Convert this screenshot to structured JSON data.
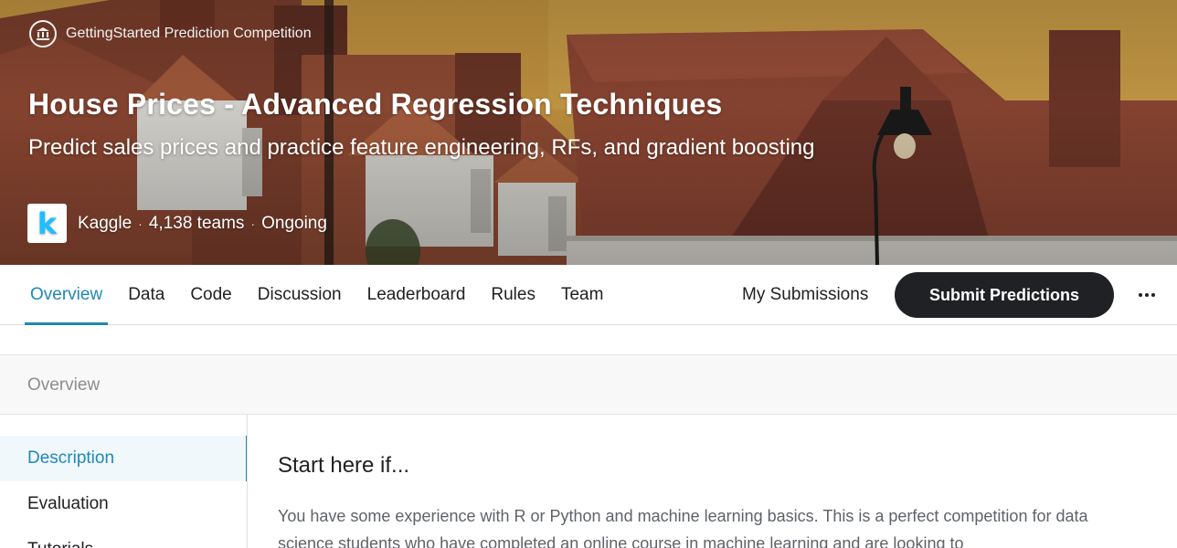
{
  "hero": {
    "competition_type": "GettingStarted Prediction Competition",
    "type_icon": "institution-icon",
    "title": "House Prices - Advanced Regression Techniques",
    "subtitle": "Predict sales prices and practice feature engineering, RFs, and gradient boosting",
    "organizer": "Kaggle",
    "organizer_logo_letter": "k",
    "teams": "4,138 teams",
    "status": "Ongoing",
    "separator": "·"
  },
  "tabs": [
    {
      "label": "Overview",
      "active": true
    },
    {
      "label": "Data"
    },
    {
      "label": "Code"
    },
    {
      "label": "Discussion"
    },
    {
      "label": "Leaderboard"
    },
    {
      "label": "Rules"
    },
    {
      "label": "Team"
    }
  ],
  "actions": {
    "my_submissions": "My Submissions",
    "submit_predictions": "Submit Predictions",
    "more_icon": "more-horizontal-icon"
  },
  "section": {
    "title": "Overview"
  },
  "side_nav": [
    {
      "label": "Description",
      "active": true
    },
    {
      "label": "Evaluation"
    },
    {
      "label": "Tutorials"
    }
  ],
  "content": {
    "heading": "Start here if...",
    "paragraph": "You have some experience with R or Python and machine learning basics. This is a perfect competition for data science students who have completed an online course in machine learning and are looking to"
  },
  "colors": {
    "accent": "#1f88b6",
    "button_dark": "#202124",
    "kaggle_blue": "#20beff"
  }
}
